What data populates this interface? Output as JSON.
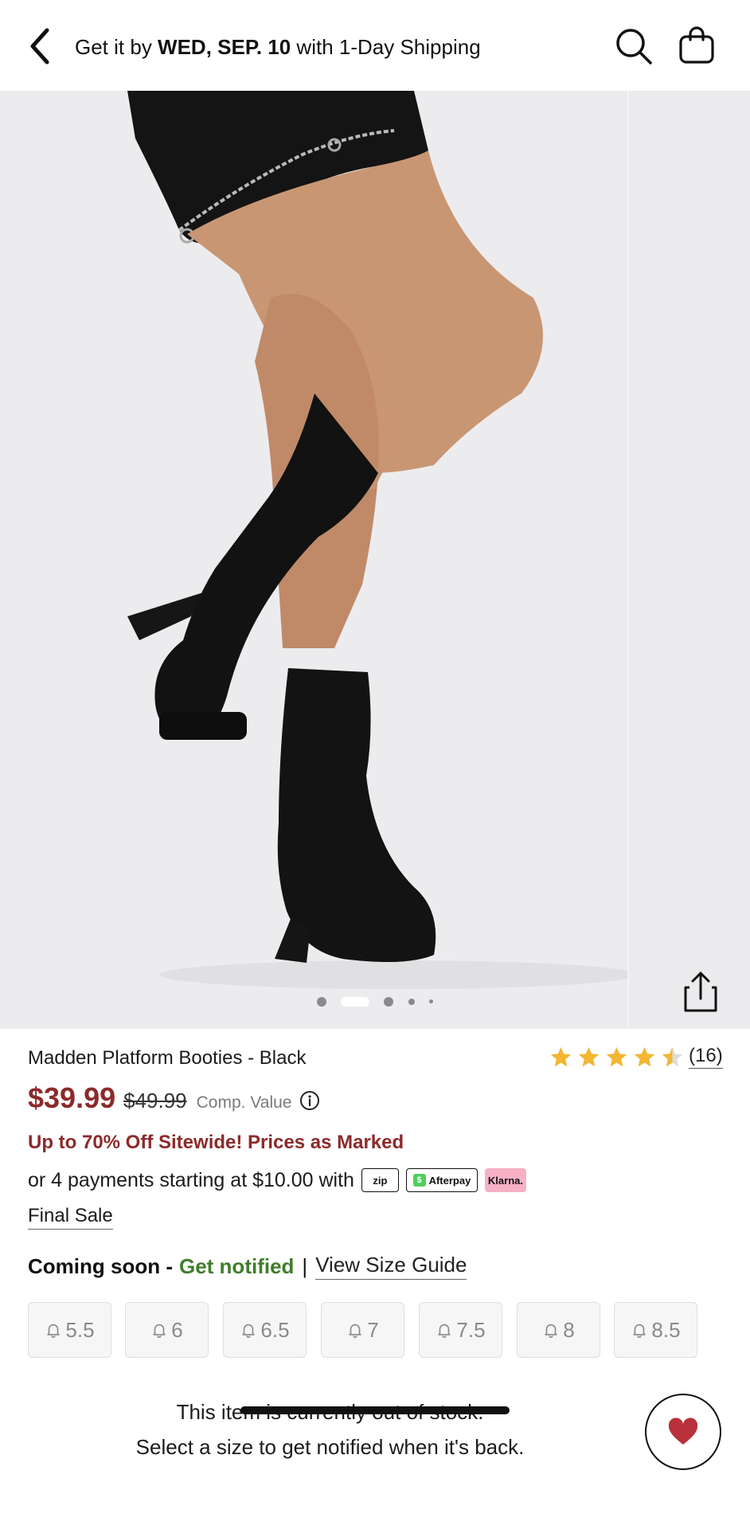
{
  "header": {
    "shipping_prefix": "Get it by ",
    "shipping_date": "WED, SEP. 10",
    "shipping_suffix": " with 1-Day Shipping"
  },
  "gallery": {
    "image_count": 5,
    "active_index": 1
  },
  "product": {
    "title": "Madden Platform Booties - Black",
    "rating": 4.5,
    "review_count": "(16)",
    "price": "$39.99",
    "original_price": "$49.99",
    "comp_label": "Comp. Value",
    "promo": "Up to 70% Off Sitewide! Prices as Marked",
    "payments_text": "or 4 payments starting at $10.00 with",
    "payment_badges": [
      "zip",
      "Afterpay",
      "Klarna."
    ],
    "final_sale": "Final Sale"
  },
  "sizes": {
    "coming_soon": "Coming soon - ",
    "get_notified": "Get notified",
    "separator": "|",
    "size_guide": "View Size Guide",
    "options": [
      "5.5",
      "6",
      "6.5",
      "7",
      "7.5",
      "8",
      "8.5"
    ]
  },
  "bottom": {
    "line1": "This item is currently out of stock.",
    "line2": "Select a size to get notified when it's back."
  },
  "colors": {
    "price": "#8c2a2a",
    "promo": "#8c2a2a",
    "notify": "#3f7d2c",
    "star": "#f2b632",
    "heart": "#b8313a"
  }
}
